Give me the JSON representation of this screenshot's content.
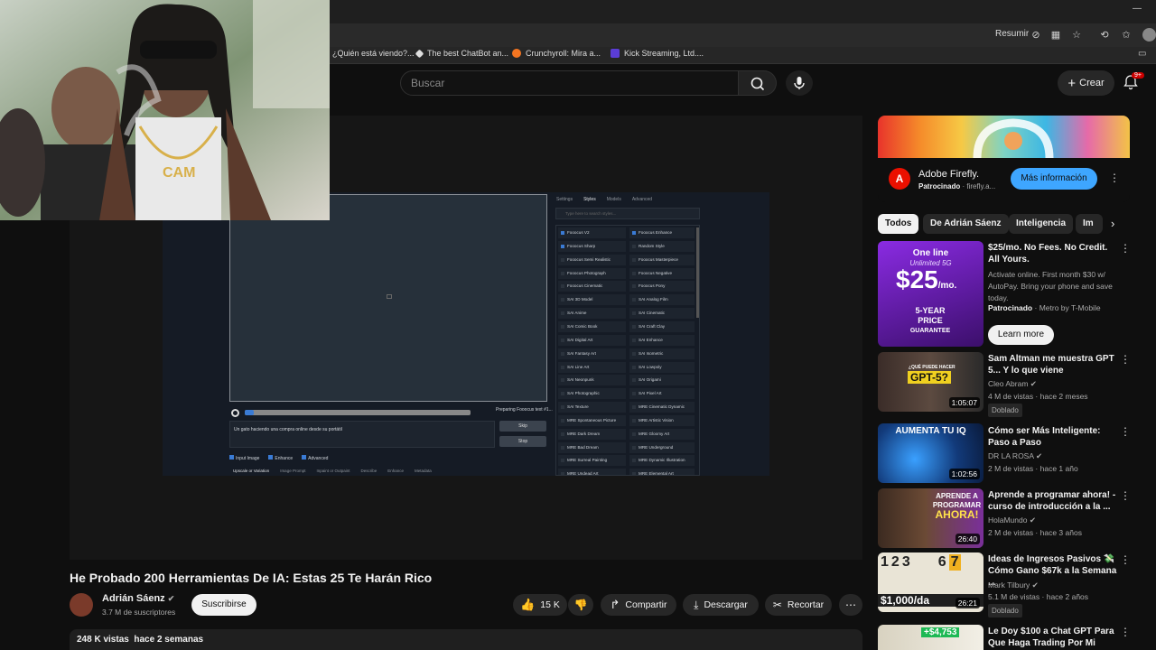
{
  "browser": {
    "toolbar": {
      "summary_label": "Resumir"
    },
    "bookmarks": [
      {
        "label": "¿Quién está viendo?...",
        "color": "#888888"
      },
      {
        "label": "The best ChatBot an...",
        "color": "#dddddd"
      },
      {
        "label": "Crunchyroll: Mira a...",
        "color": "#f47521"
      },
      {
        "label": "Kick Streaming, Ltd....",
        "color": "#5b3dd6"
      }
    ]
  },
  "header": {
    "search_placeholder": "Buscar",
    "create_label": "Crear",
    "notifications_badge": "9+"
  },
  "player": {
    "ui": {
      "tabs": [
        "Settings",
        "Styles",
        "Models",
        "Advanced"
      ],
      "style_search_placeholder": "Type here to search styles...",
      "styles_left": [
        "Fooocus V2",
        "Fooocus Sharp",
        "Fooocus Semi Realistic",
        "Fooocus Photograph",
        "Fooocus Cinematic",
        "SAI 3D Model",
        "SAI Anime",
        "SAI Comic Book",
        "SAI Digital Art",
        "SAI Fantasy Art",
        "SAI Line Art",
        "SAI Neonpunk",
        "SAI Photographic",
        "SAI Texture",
        "MRE Spontaneous Picture",
        "MRE Dark Dream",
        "MRE Bad Dream",
        "MRE Surreal Painting",
        "MRE Undead Art"
      ],
      "styles_right": [
        "Fooocus Enhance",
        "Random Style",
        "Fooocus Masterpiece",
        "Fooocus Negative",
        "Fooocus Pony",
        "SAI Analog Film",
        "SAI Cinematic",
        "SAI Craft Clay",
        "SAI Enhance",
        "SAI Isometric",
        "SAI Lowpoly",
        "SAI Origami",
        "SAI Pixel Art",
        "MRE Cinematic Dynamic",
        "MRE Artistic Vision",
        "MRE Gloomy Art",
        "MRE Underground",
        "MRE Dynamic Illustration",
        "MRE Elemental Art"
      ],
      "checked_left": [
        0,
        1
      ],
      "checked_right": [
        0
      ],
      "progress_text": "Preparing Fooocus text #1...",
      "prompt_text": "Un gato haciendo una compra online desde su portátil",
      "skip_label": "Skip",
      "stop_label": "Stop",
      "options": [
        "Input Image",
        "Enhance",
        "Advanced"
      ],
      "bottom_tabs": [
        "Upscale or Variation",
        "Image Prompt",
        "Inpaint or Outpaint",
        "Describe",
        "Enhance",
        "Metadata"
      ]
    }
  },
  "video": {
    "title": "He Probado 200 Herramientas De IA: Estas 25 Te Harán Rico",
    "channel": "Adrián Sáenz",
    "subscribers": "3.7 M de suscriptores",
    "subscribe_label": "Suscribirse",
    "likes": "15 K",
    "share_label": "Compartir",
    "download_label": "Descargar",
    "clip_label": "Recortar",
    "views_date": "248 K vistas  hace 2 semanas"
  },
  "ad": {
    "title": "Adobe Firefly.",
    "sponsored": "Patrocinado",
    "domain": "· firefly.a...",
    "cta": "Más información"
  },
  "chips": [
    "Todos",
    "De Adrián Sáenz",
    "Inteligencia",
    "Im"
  ],
  "related": [
    {
      "title": "$25/mo. No Fees. No Credit. All Yours.",
      "desc": "Activate online. First month $30 w/ AutoPay. Bring your phone and save today.",
      "sponsored": "Patrocinado",
      "advertiser": "· Metro by T-Mobile",
      "cta": "Learn more",
      "thumb_text": [
        "One line",
        "Unlimited 5G",
        "$25",
        "/mo.",
        "5-YEAR",
        "PRICE",
        "GUARANTEE"
      ]
    },
    {
      "title": "Sam Altman me muestra GPT 5... Y lo que viene",
      "channel": "Cleo Abram",
      "meta": "4 M de vistas · hace 2 meses",
      "badge": "Doblado",
      "duration": "1:05:07",
      "thumb_text": "GPT-5?",
      "thumb_small": "¿QUÉ PUEDE HACER"
    },
    {
      "title": "Cómo ser Más Inteligente: Paso a Paso",
      "channel": "DR LA ROSA",
      "meta": "2 M de vistas · hace 1 año",
      "duration": "1:02:56",
      "thumb_text": "AUMENTA TU IQ"
    },
    {
      "title": "Aprende a programar ahora! - curso de introducción a la ...",
      "channel": "HolaMundo",
      "meta": "2 M de vistas · hace 3 años",
      "duration": "26:40",
      "thumb_text": [
        "APRENDE A",
        "PROGRAMAR",
        "AHORA!"
      ]
    },
    {
      "title": "Ideas de Ingresos Pasivos 💸 Cómo Gano $67k a la Semana ...",
      "channel": "Mark Tilbury",
      "meta": "5.1 M de vistas · hace 2 años",
      "badge": "Doblado",
      "duration": "26:21",
      "thumb_text": "$1,000/da",
      "thumb_digits": [
        "1",
        "2",
        "3",
        "6",
        "7"
      ]
    },
    {
      "title": "Le Doy $100 a Chat GPT Para Que Haga Trading Por Mi",
      "thumb_text": "+$4,753"
    }
  ]
}
